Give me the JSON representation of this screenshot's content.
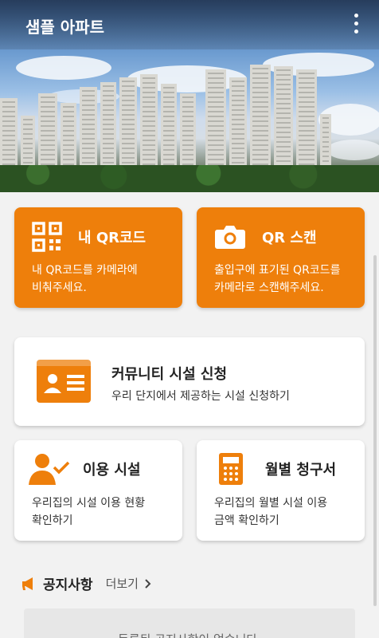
{
  "app": {
    "title": "샘플 아파트",
    "menu_icon": "more-vertical-icon"
  },
  "colors": {
    "accent": "#ee7f0b",
    "card_bg": "#ffffff",
    "page_bg": "#f2f2f2"
  },
  "cards": {
    "my_qr": {
      "title": "내 QR코드",
      "line1": "내 QR코드를 카메라에",
      "line2": "비춰주세요.",
      "icon": "qr-code-icon"
    },
    "qr_scan": {
      "title": "QR 스캔",
      "line1": "출입구에 표기된 QR코드를",
      "line2": "카메라로 스캔해주세요.",
      "icon": "camera-icon"
    },
    "community": {
      "title": "커뮤니티 시설 신청",
      "desc": "우리 단지에서 제공하는 시설 신청하기",
      "icon": "id-card-icon"
    },
    "usage": {
      "title": "이용 시설",
      "line1": "우리집의 시설 이용 현황",
      "line2": "확인하기",
      "icon": "user-check-icon"
    },
    "bill": {
      "title": "월별 청구서",
      "line1": "우리집의 월별 시설 이용",
      "line2": "금액 확인하기",
      "icon": "calculator-icon"
    }
  },
  "notice": {
    "title": "공지사항",
    "more": "더보기",
    "empty": "등록된 공지사항이 없습니다.",
    "icon": "megaphone-icon"
  }
}
